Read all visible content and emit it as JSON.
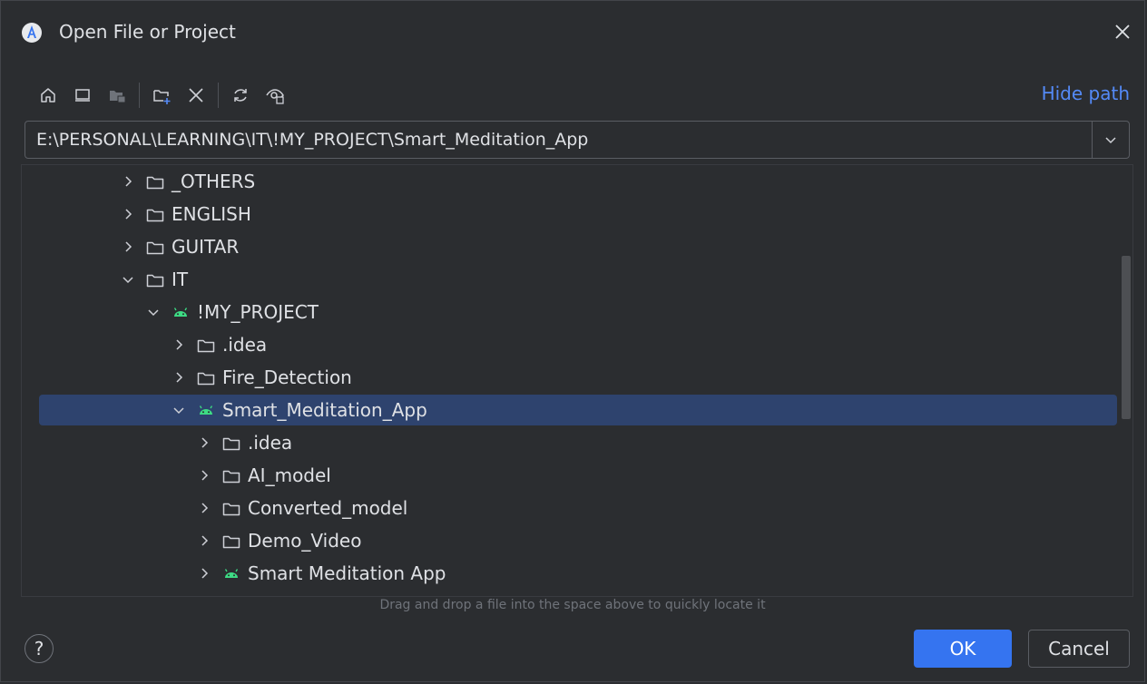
{
  "window": {
    "title": "Open File or Project"
  },
  "toolbar": {
    "buttons": [
      "home-icon",
      "desktop-icon",
      "project-folder-icon",
      "new-folder-icon",
      "delete-icon",
      "refresh-icon",
      "show-hidden-icon"
    ],
    "hide_path_label": "Hide path"
  },
  "path": {
    "value": "E:\\PERSONAL\\LEARNING\\IT\\!MY_PROJECT\\Smart_Meditation_App"
  },
  "tree": {
    "rows": [
      {
        "label": "_OTHERS",
        "icon": "folder-icon",
        "expanded": false,
        "depth": 0
      },
      {
        "label": "ENGLISH",
        "icon": "folder-icon",
        "expanded": false,
        "depth": 0
      },
      {
        "label": "GUITAR",
        "icon": "folder-icon",
        "expanded": false,
        "depth": 0
      },
      {
        "label": "IT",
        "icon": "folder-icon",
        "expanded": true,
        "depth": 0
      },
      {
        "label": "!MY_PROJECT",
        "icon": "android-icon",
        "expanded": true,
        "depth": 1
      },
      {
        "label": ".idea",
        "icon": "folder-icon",
        "expanded": false,
        "depth": 2
      },
      {
        "label": "Fire_Detection",
        "icon": "folder-icon",
        "expanded": false,
        "depth": 2
      },
      {
        "label": "Smart_Meditation_App",
        "icon": "android-icon",
        "expanded": true,
        "depth": 2,
        "selected": true
      },
      {
        "label": ".idea",
        "icon": "folder-icon",
        "expanded": false,
        "depth": 3
      },
      {
        "label": "AI_model",
        "icon": "folder-icon",
        "expanded": false,
        "depth": 3
      },
      {
        "label": "Converted_model",
        "icon": "folder-icon",
        "expanded": false,
        "depth": 3
      },
      {
        "label": "Demo_Video",
        "icon": "folder-icon",
        "expanded": false,
        "depth": 3
      },
      {
        "label": "Smart Meditation App",
        "icon": "android-icon",
        "expanded": false,
        "depth": 3
      }
    ]
  },
  "hint": "Drag and drop a file into the space above to quickly locate it",
  "footer": {
    "help": "?",
    "ok": "OK",
    "cancel": "Cancel"
  },
  "colors": {
    "accent": "#3574f0",
    "link": "#548af7",
    "selection": "#2e436e",
    "android": "#3ddc84",
    "background": "#2b2d30"
  }
}
